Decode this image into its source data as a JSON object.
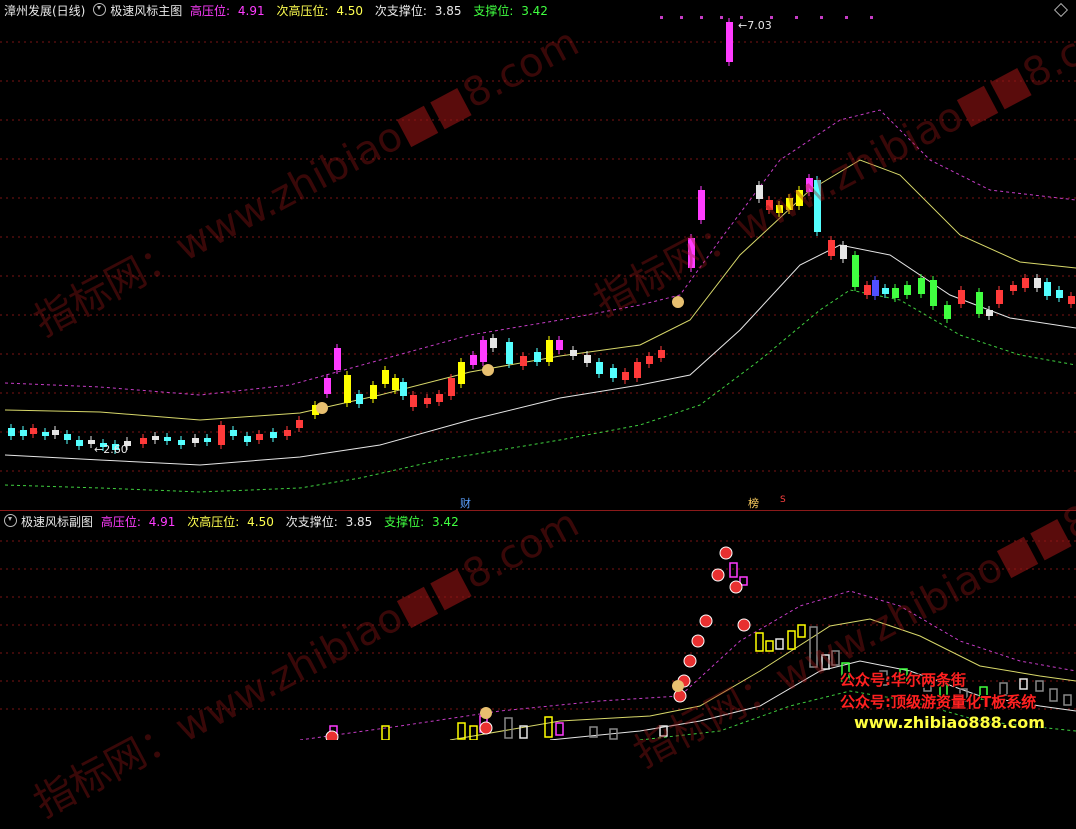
{
  "main": {
    "stock_title": "漳州发展(日线)",
    "indicator_name": "极速风标主图",
    "levels": [
      {
        "label": "高压位:",
        "value": "4.91",
        "color": "#ff3cff"
      },
      {
        "label": "次高压位:",
        "value": "4.50",
        "color": "#ffff50"
      },
      {
        "label": "次支撑位:",
        "value": "3.85",
        "color": "#e8e8e8"
      },
      {
        "label": "支撑位:",
        "value": "3.42",
        "color": "#40ff40"
      }
    ],
    "high_label": "7.03",
    "low_label": "2.60",
    "marker_cai": "财",
    "marker_bang": "榜",
    "marker_s": "S"
  },
  "sub": {
    "indicator_name": "极速风标副图",
    "levels": [
      {
        "label": "高压位:",
        "value": "4.91",
        "color": "#ff3cff"
      },
      {
        "label": "次高压位:",
        "value": "4.50",
        "color": "#ffff50"
      },
      {
        "label": "次支撑位:",
        "value": "3.85",
        "color": "#e8e8e8"
      },
      {
        "label": "支撑位:",
        "value": "3.42",
        "color": "#40ff40"
      }
    ]
  },
  "watermark": {
    "text_a": "指标网：www.zhibiao",
    "text_b": "8.com"
  },
  "promo": {
    "line1": "公众号:华尔两条街",
    "line2": "公众号:顶级游资量化T板系统",
    "line3": "www.zhibiao888.com"
  },
  "colors": {
    "up_candle": "#ff3cff",
    "yellow_candle": "#ffff00",
    "cyan_candle": "#54ffff",
    "green_candle": "#40ff40",
    "red_candle": "#ff3a3a",
    "grid": "#8b1a1a"
  }
}
